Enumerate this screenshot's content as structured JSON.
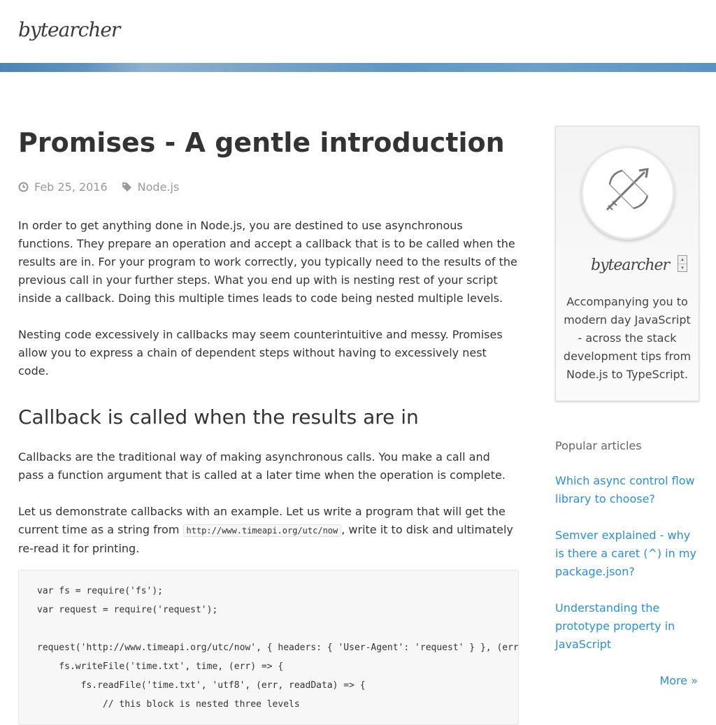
{
  "header": {
    "logo": "bytearcher"
  },
  "article": {
    "title": "Promises - A gentle introduction",
    "date": "Feb 25, 2016",
    "tag": "Node.js",
    "p1": "In order to get anything done in Node.js, you are destined to use asynchronous functions. They prepare an operation and accept a callback that is to be called when the results are in. For your program to work correctly, you typically need to the results of the previous call in your further steps. What you end up with is nesting rest of your script inside a callback. Doing this multiple times leads to code being nested multiple levels.",
    "p2": "Nesting code excessively in callbacks may seem counterintuitive and messy. Promises allow you to express a chain of dependent steps without having to excessively nest code.",
    "h2": "Callback is called when the results are in",
    "p3": "Callbacks are the traditional way of making asynchronous calls. You make a call and pass a function argument that is called at a later time when the operation is complete.",
    "p4_before": "Let us demonstrate callbacks with an example. Let us write a program that will get the current time as a string from ",
    "p4_code": "http://www.timeapi.org/utc/now",
    "p4_after": ", write it to disk and ultimately re-read it for printing.",
    "code_lines": [
      "var fs = require('fs');",
      "var request = require('request');",
      "",
      "request('http://www.timeapi.org/utc/now', { headers: { 'User-Agent': 'request' } }, (error,",
      "    fs.writeFile('time.txt', time, (err) => {",
      "        fs.readFile('time.txt', 'utf8', (err, readData) => {",
      "            // this block is nested three levels"
    ]
  },
  "sidebar": {
    "card_name": "bytearcher",
    "description": "Accompanying you to modern day JavaScript - across the stack development tips from Node.js to TypeScript.",
    "popular_heading": "Popular articles",
    "popular": [
      "Which async control flow library to choose?",
      "Semver explained - why is there a caret (^) in my package.json?",
      "Understanding the prototype property in JavaScript"
    ],
    "more": "More »",
    "scroller_up": "▴",
    "scroller_down": "▾"
  },
  "icons": {
    "date": "clock-icon",
    "tag": "tag-icon",
    "avatar": "crossbow-icon"
  }
}
